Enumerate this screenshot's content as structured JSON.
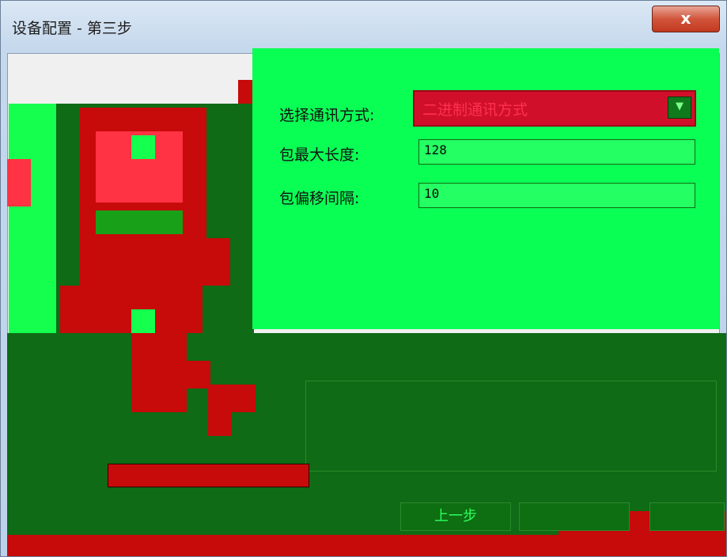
{
  "window": {
    "title": "设备配置 - 第三步",
    "close_glyph": "x"
  },
  "form": {
    "comm_mode_label": "选择通讯方式:",
    "comm_mode_value": "二进制通讯方式",
    "max_len_label": "包最大长度:",
    "max_len_value": "128",
    "offset_label": "包偏移间隔:",
    "offset_value": "10"
  },
  "footer": {
    "prev_label": "上一步"
  },
  "colors": {
    "accent_red": "#c70a0a",
    "accent_green": "#15ff4f",
    "dark_green": "#0f6b16"
  }
}
